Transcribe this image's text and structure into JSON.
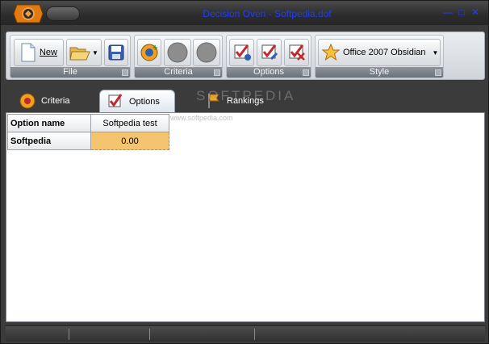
{
  "window": {
    "title": "Decision Oven - Softpedia.dof",
    "minimize": "—",
    "maximize": "□",
    "close": "✕"
  },
  "ribbon": {
    "groups": [
      {
        "caption": "File",
        "buttons": [
          {
            "label": "New",
            "icon": "new-document-icon"
          },
          {
            "label": "",
            "icon": "open-folder-icon"
          },
          {
            "label": "",
            "icon": "save-disk-icon"
          }
        ]
      },
      {
        "caption": "Criteria",
        "buttons": [
          {
            "label": "",
            "icon": "add-criterion-icon"
          },
          {
            "label": "",
            "icon": "circle-disabled-icon"
          },
          {
            "label": "",
            "icon": "circle-disabled-icon"
          }
        ]
      },
      {
        "caption": "Options",
        "buttons": [
          {
            "label": "",
            "icon": "add-option-icon"
          },
          {
            "label": "",
            "icon": "edit-option-icon"
          },
          {
            "label": "",
            "icon": "delete-option-icon"
          }
        ]
      },
      {
        "caption": "Style",
        "buttons": [
          {
            "label": "Office 2007 Obsidian",
            "icon": "star-icon"
          }
        ]
      }
    ]
  },
  "tabs": [
    {
      "label": "Criteria",
      "active": false
    },
    {
      "label": "Options",
      "active": true
    },
    {
      "label": "Rankings",
      "active": false
    }
  ],
  "watermark": "SOFTPEDIA",
  "watermark_url": "www.softpedia.com",
  "grid": {
    "header_first": "Option name",
    "columns": [
      "Softpedia test"
    ],
    "rows": [
      {
        "name": "Softpedia",
        "values": [
          "0.00"
        ]
      }
    ]
  },
  "colors": {
    "title_text": "#1e3cff",
    "selected_cell": "#f5c46e",
    "frame_dark": "#3b3b3b"
  }
}
